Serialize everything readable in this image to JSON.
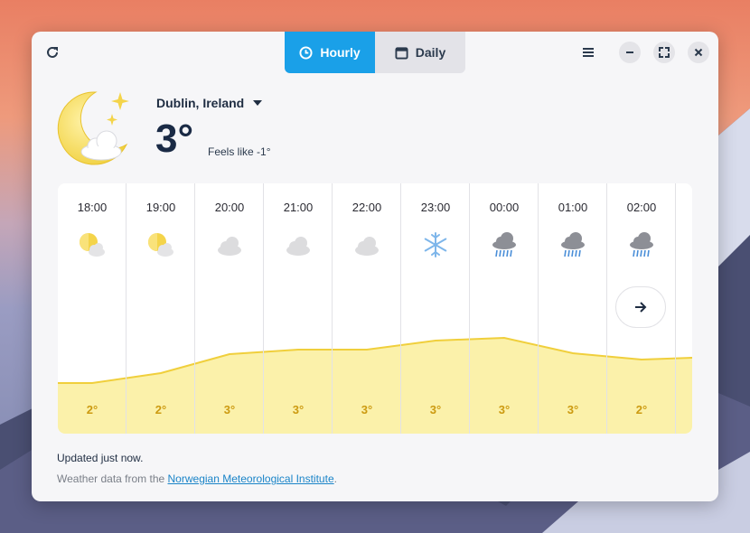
{
  "app": {
    "view_tabs": [
      {
        "label": "Hourly",
        "icon": "clock-icon",
        "active": true
      },
      {
        "label": "Daily",
        "icon": "calendar-icon",
        "active": false
      }
    ],
    "accent_color": "#1aa0e8"
  },
  "current": {
    "location": "Dublin, Ireland",
    "temperature": "3°",
    "feels_like": "Feels like -1°",
    "condition_icon": "moon-stars-cloud-icon"
  },
  "hourly": [
    {
      "time": "18:00",
      "icon": "partly-cloudy-sun-icon",
      "temp": "2°"
    },
    {
      "time": "19:00",
      "icon": "partly-cloudy-sun-icon",
      "temp": "2°"
    },
    {
      "time": "20:00",
      "icon": "cloudy-icon",
      "temp": "3°"
    },
    {
      "time": "21:00",
      "icon": "cloudy-icon",
      "temp": "3°"
    },
    {
      "time": "22:00",
      "icon": "cloudy-icon",
      "temp": "3°"
    },
    {
      "time": "23:00",
      "icon": "snowflake-icon",
      "temp": "3°"
    },
    {
      "time": "00:00",
      "icon": "rain-cloud-icon",
      "temp": "3°"
    },
    {
      "time": "01:00",
      "icon": "rain-cloud-icon",
      "temp": "3°"
    },
    {
      "time": "02:00",
      "icon": "rain-cloud-icon",
      "temp": "2°"
    }
  ],
  "footer": {
    "updated": "Updated just now.",
    "source_prefix": "Weather data from the ",
    "source_link": "Norwegian Meteorological Institute",
    "source_suffix": "."
  }
}
